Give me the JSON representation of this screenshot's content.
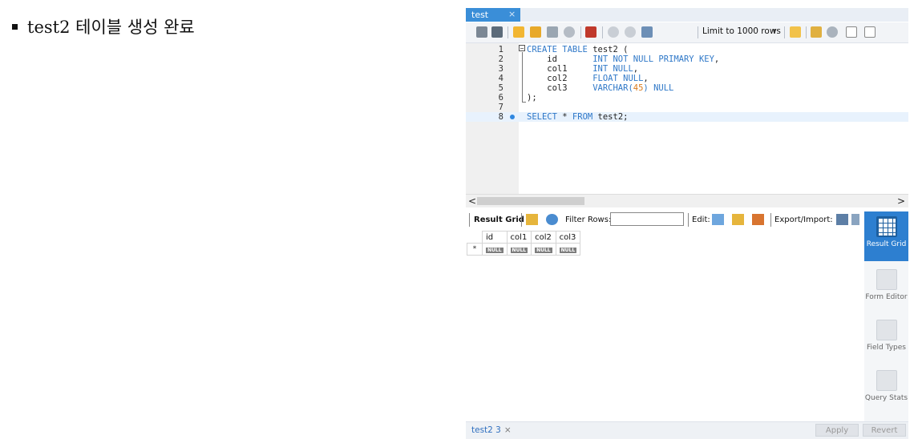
{
  "caption": {
    "text": "test2 테이블 생성 완료"
  },
  "tab": {
    "label": "test",
    "close": "×"
  },
  "toolbar": {
    "limit_label": "Limit to 1000 rows",
    "limit_arrow": "▾"
  },
  "editor": {
    "lines": [
      {
        "num": "1",
        "parts": [
          [
            "kw",
            "CREATE TABLE "
          ],
          [
            "plain",
            "test2 ("
          ]
        ]
      },
      {
        "num": "2",
        "parts": [
          [
            "plain",
            "    id       "
          ],
          [
            "kw",
            "INT NOT NULL PRIMARY KEY"
          ],
          [
            "plain",
            ","
          ]
        ]
      },
      {
        "num": "3",
        "parts": [
          [
            "plain",
            "    col1     "
          ],
          [
            "kw",
            "INT NULL"
          ],
          [
            "plain",
            ","
          ]
        ]
      },
      {
        "num": "4",
        "parts": [
          [
            "plain",
            "    col2     "
          ],
          [
            "kw",
            "FLOAT NULL"
          ],
          [
            "plain",
            ","
          ]
        ]
      },
      {
        "num": "5",
        "parts": [
          [
            "plain",
            "    col3     "
          ],
          [
            "kw",
            "VARCHAR("
          ],
          [
            "num",
            "45"
          ],
          [
            "kw",
            ") NULL"
          ]
        ]
      },
      {
        "num": "6",
        "parts": [
          [
            "plain",
            ");"
          ]
        ]
      },
      {
        "num": "7",
        "parts": []
      },
      {
        "num": "8",
        "parts": [
          [
            "kw",
            "SELECT "
          ],
          [
            "plain",
            "* "
          ],
          [
            "kw",
            "FROM "
          ],
          [
            "plain",
            "test2;"
          ]
        ]
      }
    ]
  },
  "scroll": {
    "left": "<",
    "right": ">"
  },
  "result_toolbar": {
    "result_grid": "Result Grid",
    "filter_rows": "Filter Rows:",
    "edit": "Edit:",
    "export_import": "Export/Import:"
  },
  "grid": {
    "columns": [
      "id",
      "col1",
      "col2",
      "col3"
    ],
    "row_marker": "*",
    "null_text": "NULL"
  },
  "side_panel": {
    "result_grid": "Result Grid",
    "form_editor": "Form Editor",
    "field_types": "Field Types",
    "query_stats": "Query Stats"
  },
  "bottom": {
    "tab_label": "test2 3",
    "tab_close": "×",
    "apply": "Apply",
    "revert": "Revert"
  },
  "colors": {
    "accent": "#3a8ed8",
    "keyword": "#2f78c8",
    "number": "#d97a1c",
    "active_side": "#2d7fd0"
  }
}
